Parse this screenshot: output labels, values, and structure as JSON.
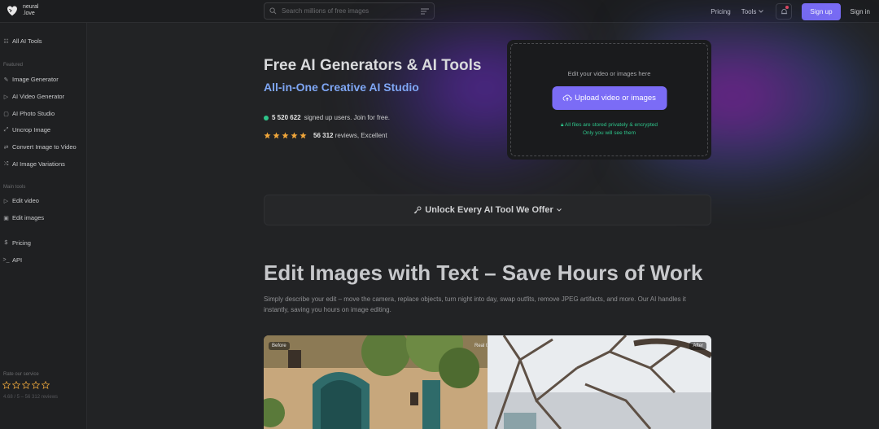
{
  "header": {
    "logo_line1": "neural",
    "logo_line2": ".love",
    "search_placeholder": "Search millions of free images",
    "nav": {
      "pricing": "Pricing",
      "tools": "Tools",
      "signup": "Sign up",
      "signin": "Sign in"
    },
    "accent": "#7b6cf6"
  },
  "sidebar": {
    "all_tools": "All AI Tools",
    "featured_label": "Featured",
    "featured": [
      {
        "label": "Image Generator",
        "icon": "brush-icon"
      },
      {
        "label": "AI Video Generator",
        "icon": "play-icon"
      },
      {
        "label": "AI Photo Studio",
        "icon": "photo-icon"
      },
      {
        "label": "Uncrop Image",
        "icon": "expand-icon"
      },
      {
        "label": "Convert Image to Video",
        "icon": "convert-icon"
      },
      {
        "label": "AI Image Variations",
        "icon": "shuffle-icon"
      }
    ],
    "main_label": "Main tools",
    "main": [
      {
        "label": "Edit video",
        "icon": "play-icon"
      },
      {
        "label": "Edit images",
        "icon": "image-icon"
      }
    ],
    "extra": [
      {
        "label": "Pricing",
        "icon": "dollar-icon"
      },
      {
        "label": "API",
        "icon": "terminal-icon"
      }
    ],
    "rate_label": "Rate our service",
    "score": "4.68 / 5 – 56 312 reviews"
  },
  "hero": {
    "title": "Free AI Generators & AI Tools",
    "subtitle": "All-in-One Creative AI Studio",
    "users_count": "5 520 622",
    "users_text": "signed up users. Join for free.",
    "reviews_count": "56 312",
    "reviews_text": "reviews, Excellent",
    "rating_stars": 5
  },
  "upload": {
    "hint": "Edit your video or images here",
    "button": "Upload video or images",
    "secure_line1": "All files are stored privately & encrypted",
    "secure_line2": "Only you will see them"
  },
  "unlock": {
    "label": "Unlock Every AI Tool We Offer"
  },
  "edit_section": {
    "title": "Edit Images with Text – Save Hours of Work",
    "description": "Simply describe your edit – move the camera, replace objects, turn night into day, swap outfits, remove JPEG artifacts, and more. Our AI handles it instantly, saving you hours on image editing.",
    "before_tag": "Before",
    "after_tag": "After",
    "mid_tag": "Real tr"
  }
}
